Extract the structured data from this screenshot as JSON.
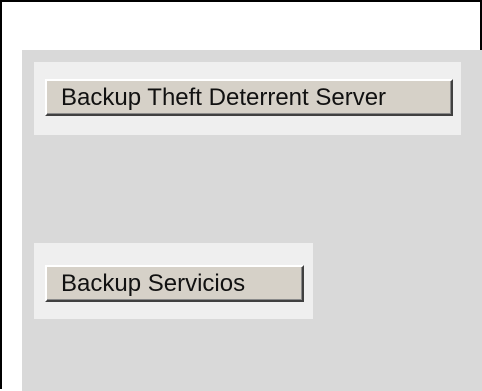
{
  "buttons": {
    "backup_theft_deterrent_server": "Backup Theft Deterrent Server",
    "backup_servicios": "Backup Servicios"
  }
}
